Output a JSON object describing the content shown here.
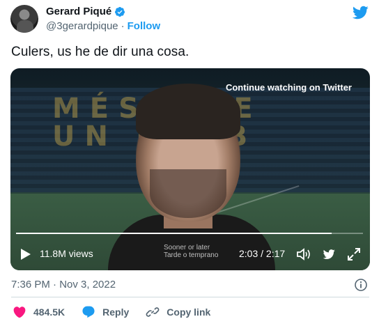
{
  "author": {
    "name": "Gerard Piqué",
    "handle": "@3gerardpique",
    "separator": "·",
    "follow_label": "Follow"
  },
  "tweet": {
    "text": "Culers, us he de dir una cosa."
  },
  "video": {
    "continue_label": "Continue watching on Twitter",
    "stand_text": "MÉS QUE\nUN CLUB",
    "subtitle_line1": "Sooner or later",
    "subtitle_line2": "Tarde o temprano",
    "views": "11.8M views",
    "time": "2:03 / 2:17",
    "progress_fraction": 0.91
  },
  "footer": {
    "timestamp": "7:36 PM · Nov 3, 2022",
    "likes": "484.5K",
    "reply_label": "Reply",
    "copy_link_label": "Copy link"
  },
  "colors": {
    "brand": "#1d9bf0",
    "like": "#f91880",
    "muted": "#536471"
  },
  "icons": [
    "verified-badge-icon",
    "twitter-logo-icon",
    "play-icon",
    "volume-icon",
    "twitter-bird-icon",
    "fullscreen-icon",
    "info-icon",
    "heart-icon",
    "reply-icon",
    "link-icon"
  ]
}
